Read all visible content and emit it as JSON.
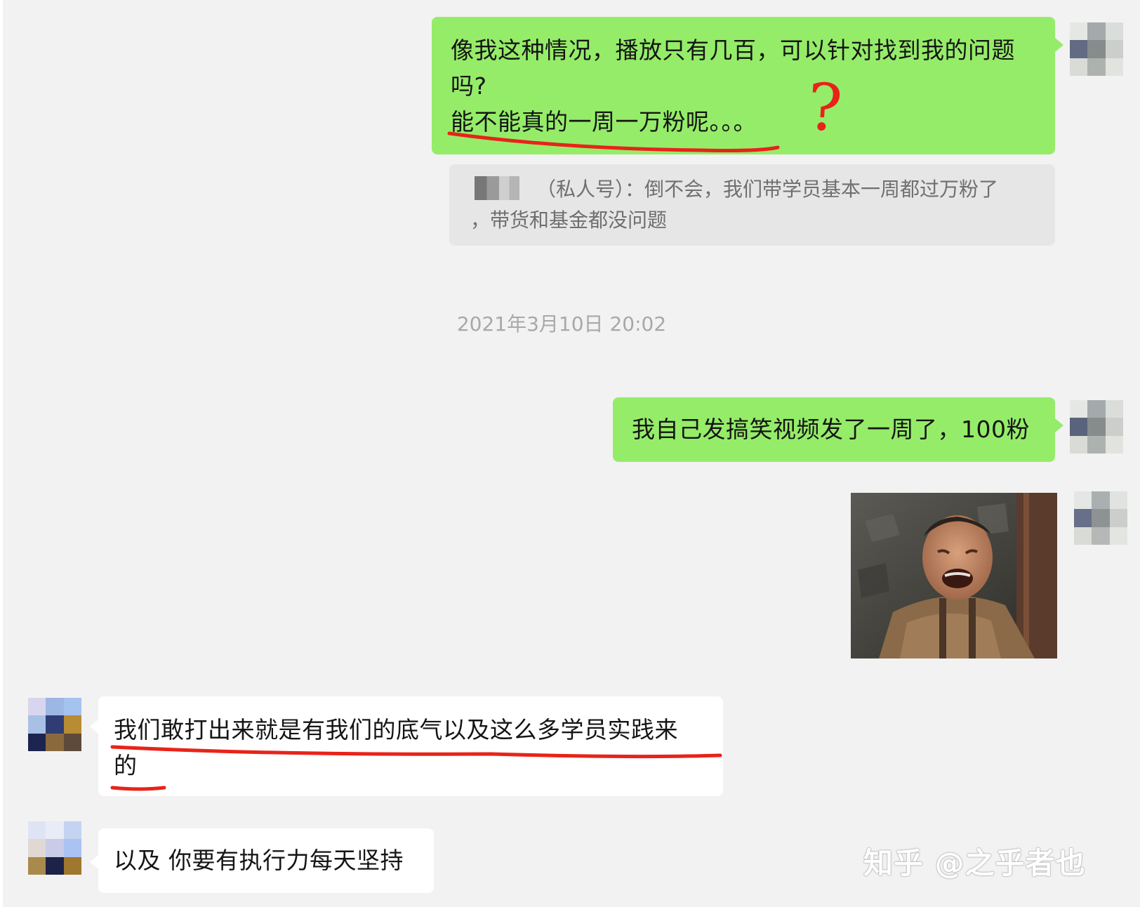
{
  "chat": {
    "messages": [
      {
        "sender": "me",
        "line1": "像我这种情况，播放只有几百，可以针对找到我的问题",
        "line2": "吗?",
        "line3": "能不能真的一周一万粉呢。。。",
        "annotation": "?"
      },
      {
        "type": "quote",
        "line1": "（私人号）：倒不会，我们带学员基本一周都过万粉了",
        "line2": "，带货和基金都没问题"
      },
      {
        "type": "timestamp",
        "text": "2021年3月10日 20:02"
      },
      {
        "sender": "me",
        "text": "我自己发搞笑视频发了一周了，100粉"
      },
      {
        "sender": "me",
        "type": "image"
      },
      {
        "sender": "other",
        "line1": "我们敢打出来就是有我们的底气以及这么多学员实践来",
        "line2": "的"
      },
      {
        "sender": "other",
        "text": "以及 你要有执行力每天坚持"
      }
    ]
  },
  "watermark": "知乎 @之乎者也",
  "colors": {
    "chat_background": "#f2f2f2",
    "my_bubble": "#95ec69",
    "their_bubble": "#ffffff",
    "quote_background": "#e6e6e6",
    "annotation_red": "#e8231a"
  }
}
